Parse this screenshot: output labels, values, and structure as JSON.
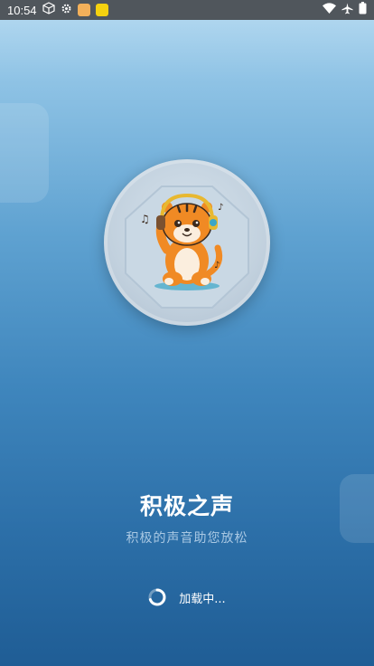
{
  "status_bar": {
    "time": "10:54",
    "left_icons": [
      "cube-icon",
      "gear-icon",
      "app-icon-tiger",
      "app-icon-yellow"
    ],
    "right_icons": [
      "wifi-icon",
      "airplane-icon",
      "battery-icon"
    ]
  },
  "app": {
    "title": "积极之声",
    "subtitle": "积极的声音助您放松",
    "loading_text": "加载中..."
  },
  "colors": {
    "bg_top": "#b9dcf2",
    "bg_bottom": "#1f5d95",
    "accent_orange": "#f08a24",
    "text_subtitle": "#a9c8e3"
  },
  "logo": {
    "icon": "tiger-headphones-logo"
  }
}
